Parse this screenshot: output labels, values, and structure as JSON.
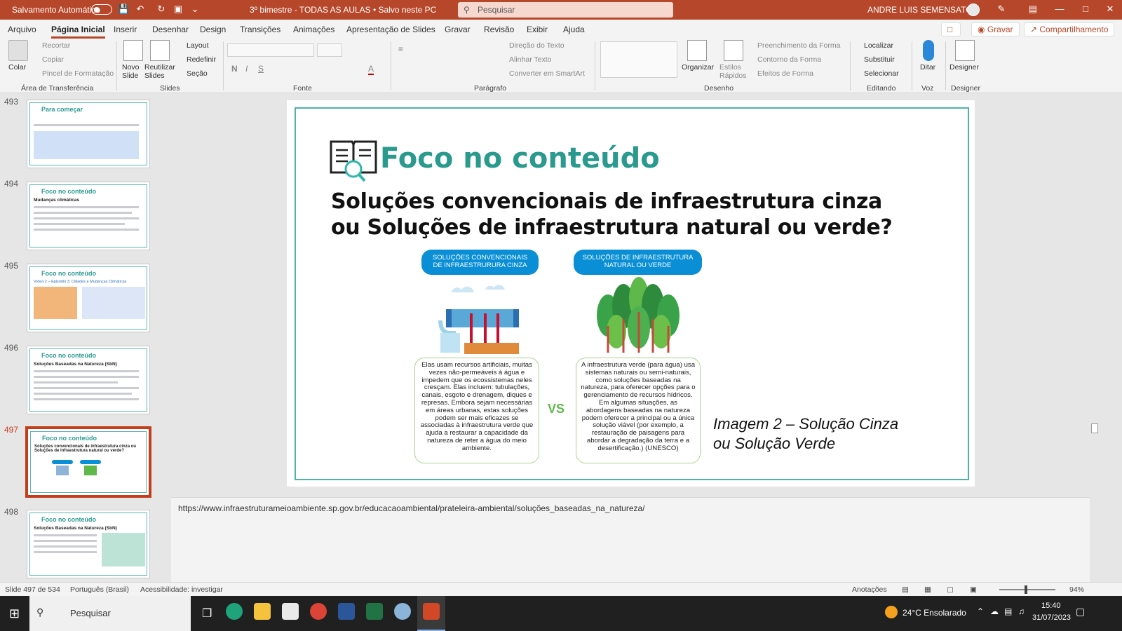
{
  "titlebar": {
    "autosave": "Salvamento Automático",
    "doc_title": "3º bimestre - TODAS AS AULAS • Salvo neste PC",
    "search_placeholder": "Pesquisar",
    "user": "ANDRE LUIS SEMENSATO"
  },
  "menu": {
    "items": [
      "Arquivo",
      "Página Inicial",
      "Inserir",
      "Desenhar",
      "Design",
      "Transições",
      "Animações",
      "Apresentação de Slides",
      "Gravar",
      "Revisão",
      "Exibir",
      "Ajuda"
    ],
    "record": "Gravar",
    "share": "Compartilhamento"
  },
  "ribbon": {
    "clipboard": {
      "paste": "Colar",
      "cut": "Recortar",
      "copy": "Copiar",
      "painter": "Pincel de Formatação",
      "label": "Área de Transferência"
    },
    "slides": {
      "new": "Novo Slide",
      "reuse": "Reutilizar Slides",
      "layout": "Layout",
      "reset": "Redefinir",
      "section": "Seção",
      "label": "Slides"
    },
    "font": {
      "label": "Fonte"
    },
    "paragraph": {
      "direction": "Direção do Texto",
      "align": "Alinhar Texto",
      "smartart": "Converter em SmartArt",
      "label": "Parágrafo"
    },
    "drawing": {
      "arrange": "Organizar",
      "quick_styles": "Estilos Rápidos",
      "fill": "Preenchimento da Forma",
      "outline": "Contorno da Forma",
      "effects": "Efeitos de Forma",
      "label": "Desenho"
    },
    "editing": {
      "find": "Localizar",
      "replace": "Substituir",
      "select": "Selecionar",
      "label": "Editando"
    },
    "voice": {
      "dictate": "Ditar",
      "label": "Voz"
    },
    "designer": {
      "btn": "Designer",
      "label": "Designer"
    }
  },
  "thumbnails": [
    {
      "num": "493",
      "title": "Para começar"
    },
    {
      "num": "494",
      "title": "Foco no conteúdo",
      "heading": "Mudanças climáticas"
    },
    {
      "num": "495",
      "title": "Foco no conteúdo",
      "heading": "Vídeo 2 – Episódio 3: Cidades e Mudanças Climáticas"
    },
    {
      "num": "496",
      "title": "Foco no conteúdo",
      "heading": "Soluções Baseadas na Natureza (SbN)"
    },
    {
      "num": "497",
      "title": "Foco no conteúdo",
      "heading": "Soluções convencionais de infraestrutura cinza ou Soluções de infraestrutura natural ou verde?"
    },
    {
      "num": "498",
      "title": "Foco no conteúdo",
      "heading": "Soluções Baseadas na Natureza (SbN)"
    }
  ],
  "slide": {
    "title": "Foco no conteúdo",
    "question_line1": "Soluções convencionais de infraestrutura cinza",
    "question_line2": "ou Soluções de infraestrutura natural ou verde?",
    "gray_label": "SOLUÇÕES CONVENCIONAIS DE INFRAESTRURURA CINZA",
    "green_label": "SOLUÇÕES DE INFRAESTRUTURA NATURAL OU VERDE",
    "gray_text": "Elas usam recursos artificiais, muitas vezes não-permeáveis à água e impedem que os ecossistemas neles cresçam. Elas incluem: tubulações, canais, esgoto e drenagem, diques e represas. Embora sejam necessárias em áreas urbanas, estas soluções podem ser mais eficazes se associadas à infraestrutura verde que ajuda a restaurar a capacidade da natureza de reter a água do meio ambiente.",
    "green_text": "A infraestrutura verde (para água) usa sistemas naturais ou semi-naturais, como soluções baseadas na natureza, para oferecer opções para o gerenciamento de recursos hídricos. Em algumas situações, as abordagens baseadas na natureza podem oferecer a principal ou a única solução viável (por exemplo, a restauração de paisagens para abordar a degradação da terra e a desertificação.) (UNESCO)",
    "vs": "VS",
    "caption_line1": "Imagem 2 – Solução Cinza",
    "caption_line2": "ou Solução Verde"
  },
  "notes": {
    "url": "https://www.infraestruturameioambiente.sp.gov.br/educacaoambiental/prateleira-ambiental/soluções_baseadas_na_natureza/"
  },
  "status": {
    "slide_count": "Slide 497 de 534",
    "language": "Português (Brasil)",
    "accessibility": "Acessibilidade: investigar",
    "notes": "Anotações",
    "zoom": "94%"
  },
  "taskbar": {
    "search": "Pesquisar",
    "weather": "24°C Ensolarado",
    "time": "15:40",
    "date": "31/07/2023"
  },
  "colors": {
    "accent": "#b7472a",
    "teal": "#2a9a8f",
    "gray_label": "#0a8fd6",
    "green": "#5fb84a"
  }
}
